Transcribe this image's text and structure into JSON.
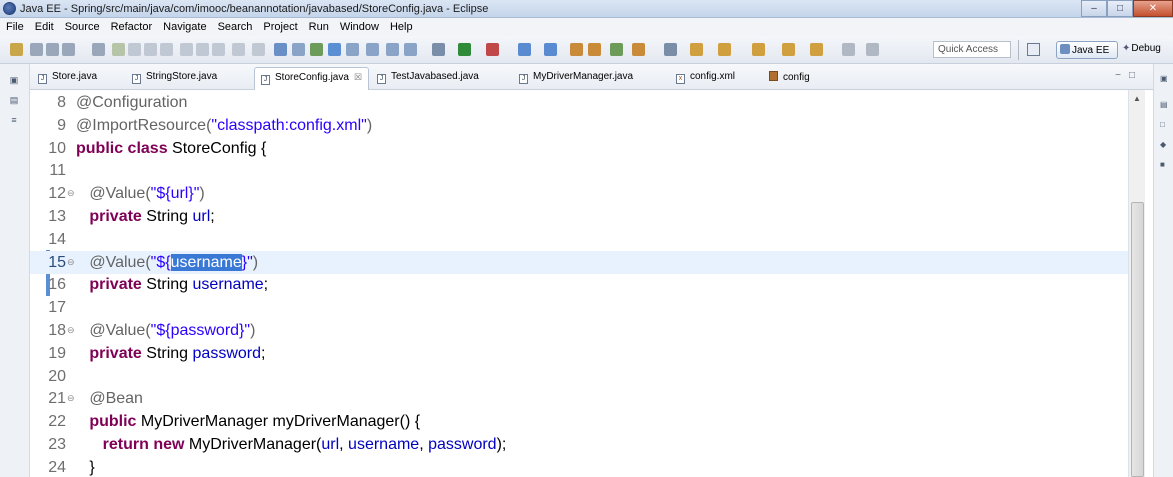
{
  "window": {
    "title": "Java EE - Spring/src/main/java/com/imooc/beanannotation/javabased/StoreConfig.java - Eclipse",
    "buttons": [
      "–",
      "□",
      "✕"
    ]
  },
  "menu": [
    "File",
    "Edit",
    "Source",
    "Refactor",
    "Navigate",
    "Search",
    "Project",
    "Run",
    "Window",
    "Help"
  ],
  "toolbar": {
    "quick_access_placeholder": "Quick Access",
    "perspectives": [
      "Java EE",
      "Debug"
    ]
  },
  "tabs": [
    {
      "label": "Store.java",
      "icon": "java-file-icon",
      "active": false
    },
    {
      "label": "StringStore.java",
      "icon": "java-file-icon",
      "active": false
    },
    {
      "label": "StoreConfig.java",
      "icon": "java-file-icon",
      "active": true,
      "close": "☒"
    },
    {
      "label": "TestJavabased.java",
      "icon": "java-file-icon",
      "active": false
    },
    {
      "label": "MyDriverManager.java",
      "icon": "java-file-icon",
      "active": false
    },
    {
      "label": "config.xml",
      "icon": "xml-file-icon",
      "active": false
    },
    {
      "label": "config",
      "icon": "config-file-icon",
      "active": false
    }
  ],
  "editor": {
    "current_line": 15,
    "selection": "username",
    "lines": [
      {
        "n": "8",
        "fold": "",
        "tokens": [
          [
            "ann",
            "@Configuration"
          ]
        ]
      },
      {
        "n": "9",
        "fold": "",
        "tokens": [
          [
            "ann",
            "@ImportResource("
          ],
          [
            "str",
            "\"classpath:config.xml\""
          ],
          [
            "ann",
            ")"
          ]
        ]
      },
      {
        "n": "10",
        "fold": "",
        "tokens": [
          [
            "kw",
            "public class "
          ],
          [
            "txt",
            "StoreConfig {"
          ]
        ]
      },
      {
        "n": "11",
        "fold": "",
        "tokens": []
      },
      {
        "n": "12",
        "fold": "⊖",
        "tokens": [
          [
            "txt",
            "   "
          ],
          [
            "ann",
            "@Value("
          ],
          [
            "str",
            "\"${url}\""
          ],
          [
            "ann",
            ")"
          ]
        ]
      },
      {
        "n": "13",
        "fold": "",
        "tokens": [
          [
            "txt",
            "   "
          ],
          [
            "kw",
            "private "
          ],
          [
            "txt",
            "String "
          ],
          [
            "fld",
            "url"
          ],
          [
            "txt",
            ";"
          ]
        ]
      },
      {
        "n": "14",
        "fold": "",
        "tokens": []
      },
      {
        "n": "15",
        "fold": "⊖",
        "tokens": [
          [
            "txt",
            "   "
          ],
          [
            "ann",
            "@Value("
          ],
          [
            "str",
            "\"${"
          ],
          [
            "sel",
            "username"
          ],
          [
            "str",
            "}\""
          ],
          [
            "ann",
            ")"
          ]
        ]
      },
      {
        "n": "16",
        "fold": "",
        "tokens": [
          [
            "txt",
            "   "
          ],
          [
            "kw",
            "private "
          ],
          [
            "txt",
            "String "
          ],
          [
            "fld",
            "username"
          ],
          [
            "txt",
            ";"
          ]
        ]
      },
      {
        "n": "17",
        "fold": "",
        "tokens": []
      },
      {
        "n": "18",
        "fold": "⊖",
        "tokens": [
          [
            "txt",
            "   "
          ],
          [
            "ann",
            "@Value("
          ],
          [
            "str",
            "\"${password}\""
          ],
          [
            "ann",
            ")"
          ]
        ]
      },
      {
        "n": "19",
        "fold": "",
        "tokens": [
          [
            "txt",
            "   "
          ],
          [
            "kw",
            "private "
          ],
          [
            "txt",
            "String "
          ],
          [
            "fld",
            "password"
          ],
          [
            "txt",
            ";"
          ]
        ]
      },
      {
        "n": "20",
        "fold": "",
        "tokens": []
      },
      {
        "n": "21",
        "fold": "⊖",
        "tokens": [
          [
            "txt",
            "   "
          ],
          [
            "ann",
            "@Bean"
          ]
        ]
      },
      {
        "n": "22",
        "fold": "",
        "tokens": [
          [
            "txt",
            "   "
          ],
          [
            "kw",
            "public "
          ],
          [
            "txt",
            "MyDriverManager myDriverManager() {"
          ]
        ]
      },
      {
        "n": "23",
        "fold": "",
        "tokens": [
          [
            "txt",
            "      "
          ],
          [
            "kw",
            "return new "
          ],
          [
            "txt",
            "MyDriverManager("
          ],
          [
            "fld",
            "url"
          ],
          [
            "txt",
            ", "
          ],
          [
            "fld",
            "username"
          ],
          [
            "txt",
            ", "
          ],
          [
            "fld",
            "password"
          ],
          [
            "txt",
            ");"
          ]
        ]
      },
      {
        "n": "24",
        "fold": "",
        "tokens": [
          [
            "txt",
            "   }"
          ]
        ]
      }
    ]
  },
  "colors": {
    "keyword": "#7f0055",
    "string": "#2a00ff",
    "annotation": "#646464",
    "field": "#0000c0",
    "selection": "#3a78d6",
    "current_line": "#e8f2fe"
  }
}
